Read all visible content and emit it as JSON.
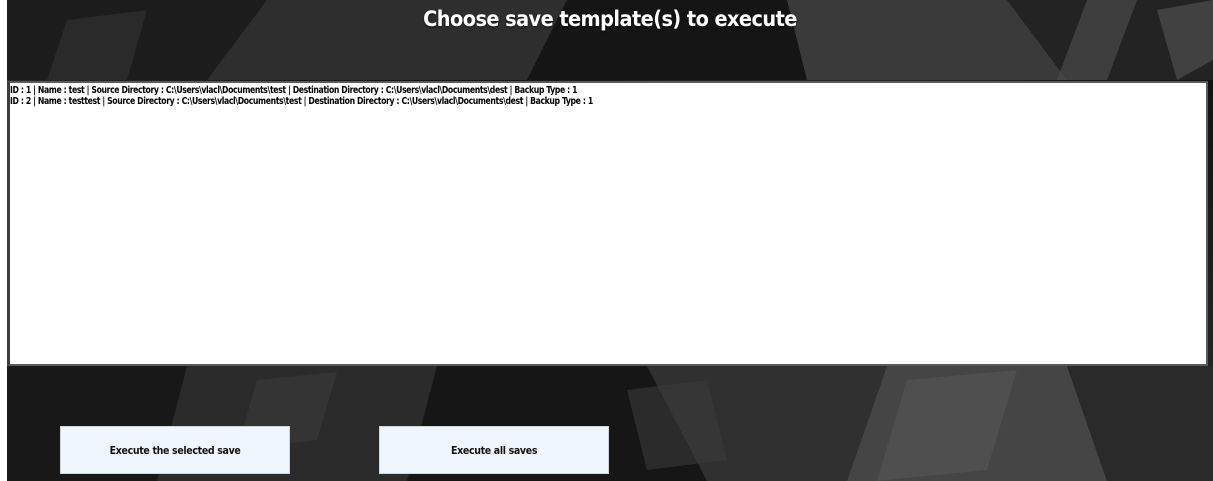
{
  "window": {
    "title": "Choose save template(s) to execute"
  },
  "saves_list": {
    "items": [
      "ID : 1 | Name : test | Source Directory : C:\\Users\\vlacl\\Documents\\test | Destination Directory : C:\\Users\\vlacl\\Documents\\dest | Backup Type : 1",
      "ID : 2 | Name : testtest | Source Directory : C:\\Users\\vlacl\\Documents\\test | Destination Directory : C:\\Users\\vlacl\\Documents\\dest | Backup Type : 1"
    ]
  },
  "buttons": {
    "execute_selected": "Execute the selected save",
    "execute_all": "Execute all saves"
  },
  "colors": {
    "button_background": "#f0f6fe",
    "title_text": "#ffffff",
    "background_dark": "#1a1a1a"
  }
}
